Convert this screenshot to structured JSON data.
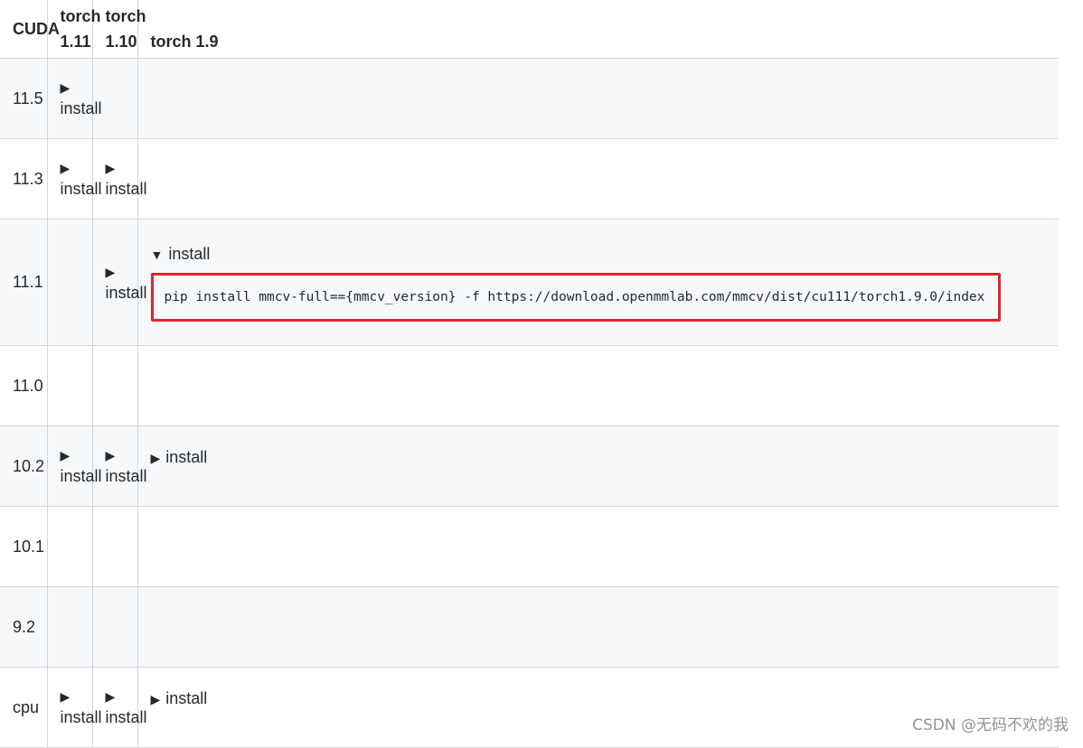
{
  "headers": {
    "cuda": "CUDA",
    "torch_111": "torch 1.11",
    "torch_110": "torch 1.10",
    "torch_19": "torch 1.9"
  },
  "rows": [
    {
      "cuda": "11.5",
      "t111": "install",
      "t110": "",
      "t19": ""
    },
    {
      "cuda": "11.3",
      "t111": "install",
      "t110": "install",
      "t19": ""
    },
    {
      "cuda": "11.1",
      "t111": "",
      "t110": "install",
      "t19": "install"
    },
    {
      "cuda": "11.0",
      "t111": "",
      "t110": "",
      "t19": ""
    },
    {
      "cuda": "10.2",
      "t111": "install",
      "t110": "install",
      "t19": "install"
    },
    {
      "cuda": "10.1",
      "t111": "",
      "t110": "",
      "t19": ""
    },
    {
      "cuda": "9.2",
      "t111": "",
      "t110": "",
      "t19": ""
    },
    {
      "cuda": "cpu",
      "t111": "install",
      "t110": "install",
      "t19": "install"
    }
  ],
  "collapsed_marker": "▶",
  "expanded_marker": "▼",
  "expanded_command": "pip install mmcv-full=={mmcv_version} -f https://download.openmmlab.com/mmcv/dist/cu111/torch1.9.0/index",
  "highlight_color": "#e3232c",
  "watermark": "CSDN @无码不欢的我"
}
